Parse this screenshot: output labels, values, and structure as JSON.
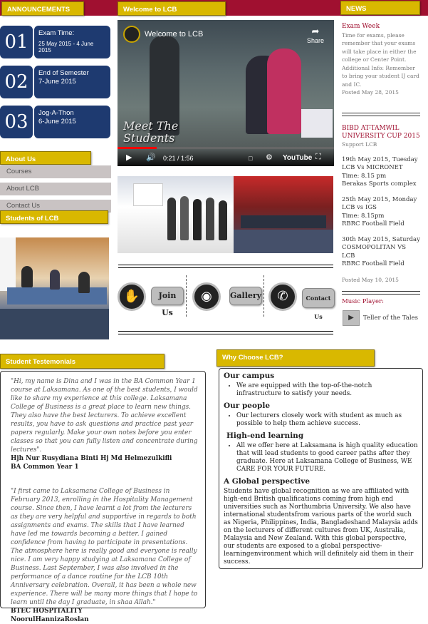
{
  "headers": {
    "announcements": "ANNOUNCEMENTS",
    "welcome": "Welcome to LCB",
    "news": "NEWS",
    "about": "About Us",
    "students": "Students of LCB",
    "testimonials": "Student Testemonials",
    "why": "Why Choose LCB?"
  },
  "announcements": [
    {
      "num": "01",
      "title": "Exam Time:",
      "date": "25 May 2015 - 4 June 2015"
    },
    {
      "num": "02",
      "title": "End of Semester",
      "date": "7-June 2015"
    },
    {
      "num": "03",
      "title": "Jog-A-Thon",
      "date": "6-June 2015"
    }
  ],
  "about_menu": [
    "Courses",
    "About LCB",
    "Contact Us"
  ],
  "video": {
    "title": "Welcome to LCB",
    "share": "Share",
    "overlay": "Meet The Students",
    "time": "0:21 / 1:56",
    "progress": 0.18,
    "brand": "YouTube"
  },
  "social": {
    "join": "Join Us",
    "gallery": "Gallery",
    "contact": "Contact Us"
  },
  "news": {
    "item1": {
      "title": "Exam Week",
      "body": "Time for exams, please remember that your exams will take place in either the college or Center Point.",
      "extra": "Additional Info: Remember to bring your student IJ card and IC.",
      "posted": "Posted May 28, 2015"
    },
    "item2": {
      "title": "BIBD AT-TAMWIL UNIVERSITY CUP 2015",
      "sub": "Support LCB",
      "e1": [
        "19th May 2015, Tuesday",
        "LCB Vs MICRONET",
        "Time: 8.15 pm",
        "Berakas Sports complex"
      ],
      "e2": [
        "25th May 2015, Monday",
        "LCB vs IGS",
        "Time: 8.15pm",
        "RBRC Football Field"
      ],
      "e3": [
        "30th May 2015, Saturday",
        "COSMOPOLITAN VS LCB",
        "RBRC Football Field"
      ],
      "posted": "Posted May 10, 2015"
    },
    "player_label": "Music Player:",
    "track": "Teller of the Tales"
  },
  "testimonials": [
    {
      "quote": "\"Hi, my name is Dina and I was in the BA Common Year 1 course at Laksamana. As one of the best students, I would like to share my experience at this college. Laksamana College of Business is a great place to learn new things. They also have the best lecturers. To achieve excellent results, you have to ask questions and practice past year papers regularly. Make your own notes before you enter classes so that you can fully listen and concentrate during lectures\".",
      "name": "Hjh Nur Rusydiana Binti Hj Md Helmezulkifli",
      "course": "BA Common Year 1"
    },
    {
      "quote": "\"I first came to Laksamana College of Business in February 2013, enrolling in the Hospitality Management course. Since then, I have learnt a lot from the lecturers as they are very helpful and supportive in regards to both assignments and exams. The skills that I have learned have led me towards becoming a better. I gained confidence from having to participate in presentations. The atmosphere here is really good and everyone is really nice. I am very happy studying at Laksamana College of Business. Last September, I was also involved in the performance of a dance routine for the LCB 10th Anniversary celebration. Overall, it has been a whole new experience. There will be many more things that I hope to learn until the day I graduate, in shaa Allah.\"",
      "name": "BTEC HOSPITALITY",
      "course": "NoorulHannizaRoslan"
    }
  ],
  "why": {
    "campus_h": "Our campus",
    "campus": "We are equipped with the top-of-the-notch infrastructure to satisfy your needs.",
    "people_h": "Our people",
    "people": "Our lecturers closely work with student as much as possible to help them achieve success.",
    "learning_h": "High-end learning",
    "learning": "All we offer here at Laksamana is high quality education that will lead students to good career paths after they graduate. Here at Laksamana College of Business, WE CARE FOR YOUR FUTURE.",
    "global_h": "A Global perspective",
    "global": "Students have global recognition as we are affiliated with high-end British qualifications coming from high end universities such as Northumbria University. We also have international studentsfrom various parts of the world such as Nigeria, Philippines, India, Bangladeshand Malaysia adds on the lecturers of different cultures from UK, Australia, Malaysia and New Zealand. With this global perspective, our students are exposed to a global perspective-learningenvironment which will definitely aid them in their success."
  },
  "colors": {
    "topbar": "#a01030",
    "tab": "#d9b800",
    "announcement": "#1e3a70"
  }
}
